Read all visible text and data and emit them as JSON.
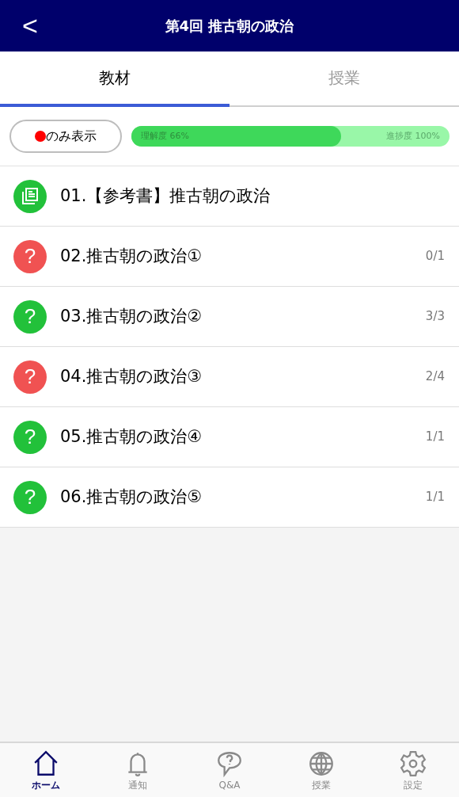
{
  "header": {
    "back": "<",
    "title": "第4回 推古朝の政治"
  },
  "tabs": [
    {
      "label": "教材",
      "selected": true
    },
    {
      "label": "授業",
      "selected": false
    }
  ],
  "filter": {
    "label": "のみ表示",
    "color": "#ff0000"
  },
  "progress": {
    "understanding": {
      "label": "理解度 66%",
      "level": 0.66
    },
    "progress": {
      "label": "進捗度 100%"
    }
  },
  "items": [
    {
      "kind": "reference",
      "title": "01.【参考書】推古朝の政治",
      "color": "#22c13a"
    },
    {
      "kind": "quiz",
      "mark": "?",
      "title": "02.推古朝の政治①",
      "count": "0/1",
      "color": "#f05252"
    },
    {
      "kind": "quiz",
      "mark": "?",
      "title": "03.推古朝の政治②",
      "count": "3/3",
      "color": "#22c13a"
    },
    {
      "kind": "quiz",
      "mark": "?",
      "title": "04.推古朝の政治③",
      "count": "2/4",
      "color": "#f05252"
    },
    {
      "kind": "quiz",
      "mark": "?",
      "title": "05.推古朝の政治④",
      "count": "1/1",
      "color": "#22c13a"
    },
    {
      "kind": "quiz",
      "mark": "?",
      "title": "06.推古朝の政治⑤",
      "count": "1/1",
      "color": "#22c13a"
    }
  ],
  "bottom_nav": [
    {
      "kind": "home",
      "label": "ホーム",
      "selected": true
    },
    {
      "kind": "bell",
      "label": "通知",
      "selected": false
    },
    {
      "kind": "qa",
      "label": "Q&A",
      "selected": false
    },
    {
      "kind": "globe",
      "label": "授業",
      "selected": false
    },
    {
      "kind": "gear",
      "label": "設定",
      "selected": false
    }
  ]
}
